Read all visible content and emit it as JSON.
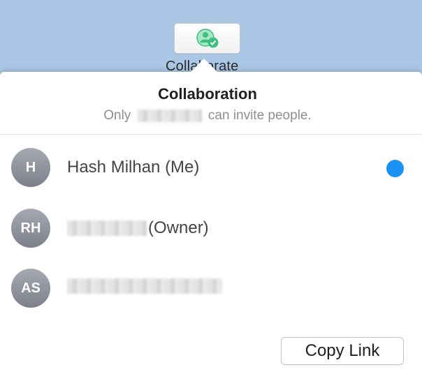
{
  "toolbar": {
    "collaborate_label": "Collaborate",
    "collaborate_icon": "collaborate-person-check-icon",
    "icon_color": "#3fbf7f"
  },
  "popover": {
    "title": "Collaboration",
    "subtitle_prefix": "Only",
    "subtitle_suffix": "can invite people.",
    "subtitle_redacted": true
  },
  "participants": [
    {
      "initials": "H",
      "name": "Hash Milhan (Me)",
      "online_indicator": true,
      "indicator_color": "#1b91f4"
    },
    {
      "initials": "RH",
      "name_redacted": true,
      "role": "(Owner)"
    },
    {
      "initials": "AS",
      "name_redacted": true
    }
  ],
  "actions": {
    "copy_link_label": "Copy Link"
  }
}
